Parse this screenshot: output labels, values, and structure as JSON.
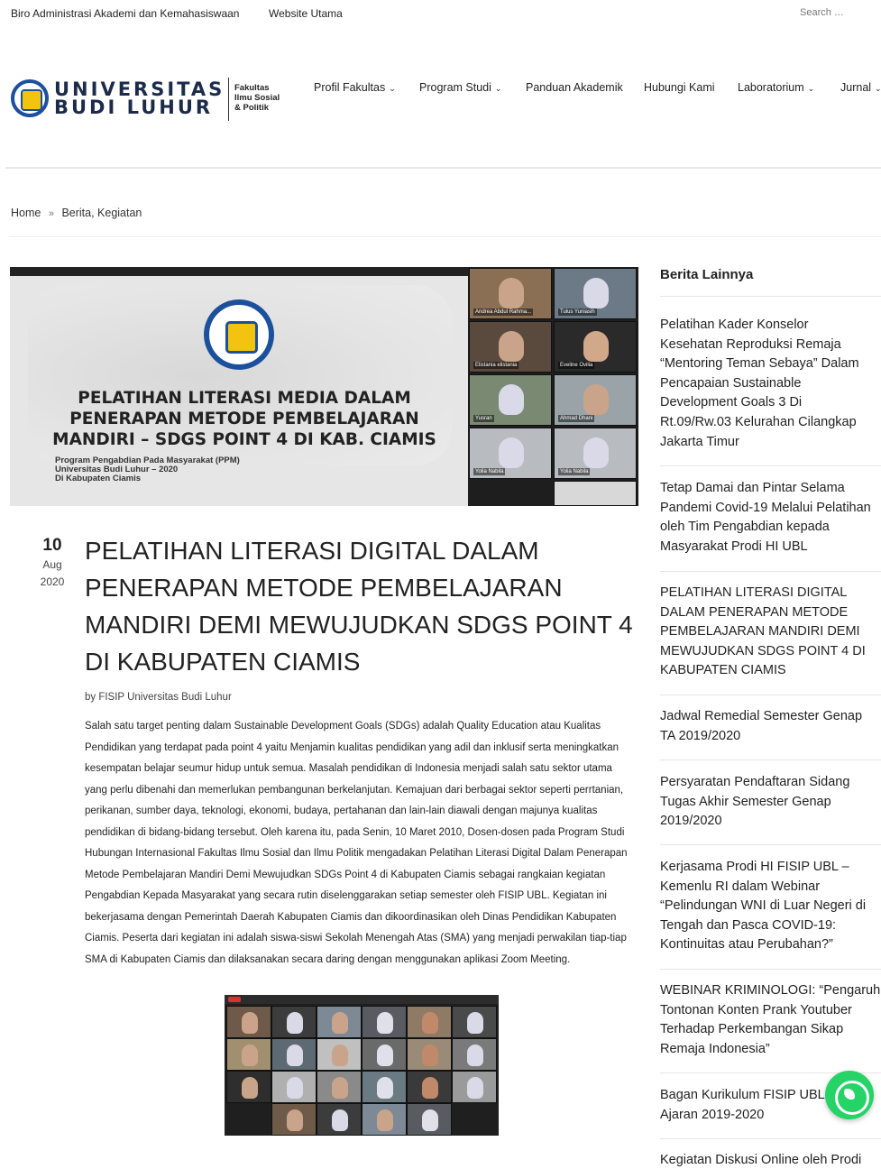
{
  "topbar": {
    "links": [
      "Biro Administrasi Akademi dan Kemahasiswaan",
      "Website Utama"
    ],
    "search_placeholder": "Search …"
  },
  "logo": {
    "line1": "UNIVERSITAS",
    "line2": "BUDI LUHUR",
    "faculty": [
      "Fakultas",
      "Ilmu Sosial",
      "& Politik"
    ]
  },
  "nav": {
    "items": [
      {
        "label": "Profil Fakultas",
        "dropdown": true
      },
      {
        "label": "Program Studi",
        "dropdown": true
      },
      {
        "label": "Panduan Akademik",
        "dropdown": false
      },
      {
        "label": "Hubungi Kami",
        "dropdown": false
      },
      {
        "label": "Laboratorium",
        "dropdown": true
      },
      {
        "label": "Jurnal",
        "dropdown": true
      }
    ]
  },
  "breadcrumb": {
    "home": "Home",
    "separator": "»",
    "current": "Berita, Kegiatan"
  },
  "feature_image": {
    "title": "PELATIHAN LITERASI MEDIA DALAM PENERAPAN METODE PEMBELAJARAN MANDIRI – SDGS POINT 4 DI KAB. CIAMIS",
    "subtitle": [
      "Program Pengabdian Pada Masyarakat (PPM)",
      "Universitas Budi Luhur – 2020",
      "Di Kabupaten Ciamis"
    ],
    "participants": [
      "Andrea Abdul Rahma...",
      "Tulus Yuniasih",
      "Elistania elistania",
      "Eveline Ovilia",
      "Yusran",
      "Ahmad Dhani",
      "Yolia Nabila",
      "Yolia Nabila"
    ]
  },
  "post": {
    "date": {
      "day": "10",
      "month": "Aug",
      "year": "2020"
    },
    "title": "PELATIHAN LITERASI DIGITAL DALAM PENERAPAN METODE PEMBELAJARAN MANDIRI DEMI MEWUJUDKAN SDGS POINT 4 DI KABUPATEN CIAMIS",
    "author": "by FISIP Universitas Budi Luhur",
    "body": "Salah satu target penting dalam Sustainable Development Goals (SDGs) adalah Quality Education atau Kualitas Pendidikan yang terdapat pada point 4 yaitu Menjamin kualitas pendidikan yang adil dan inklusif serta meningkatkan kesempatan belajar seumur hidup untuk semua. Masalah pendidikan di Indonesia menjadi salah satu sektor utama yang perlu dibenahi dan memerlukan pembangunan berkelanjutan. Kemajuan dari berbagai sektor seperti perrtanian, perikanan, sumber daya, teknologi, ekonomi, budaya, pertahanan dan lain-lain diawali dengan majunya kualitas pendidikan di bidang-bidang tersebut. Oleh karena itu, pada Senin, 10 Maret 2010, Dosen-dosen pada Program Studi Hubungan Internasional Fakultas Ilmu Sosial dan Ilmu Politik mengadakan Pelatihan Literasi Digital Dalam Penerapan Metode Pembelajaran Mandiri Demi Mewujudkan SDGs Point 4 di Kabupaten Ciamis sebagai rangkaian kegiatan Pengabdian Kepada Masyarakat yang secara rutin diselenggarakan setiap semester oleh FISIP UBL. Kegiatan ini bekerjasama dengan Pemerintah Daerah Kabupaten Ciamis dan dikoordinasikan oleh Dinas Pendidikan Kabupaten Ciamis. Peserta dari kegiatan ini adalah siswa-siswi Sekolah Menengah Atas (SMA) yang menjadi perwakilan tiap-tiap SMA di Kabupaten Ciamis dan dilaksanakan secara daring dengan menggunakan aplikasi Zoom Meeting."
  },
  "sidebar": {
    "heading": "Berita Lainnya",
    "items": [
      "Pelatihan Kader Konselor\nKesehatan Reproduksi Remaja\n“Mentoring Teman Sebaya” Dalam\nPencapaian Sustainable\nDevelopment Goals 3 Di\nRt.09/Rw.03 Kelurahan Cilangkap\nJakarta Timur",
      "Tetap Damai dan Pintar Selama\nPandemi Covid-19 Melalui Pelatihan\noleh Tim Pengabdian kepada\nMasyarakat Prodi HI UBL",
      "PELATIHAN LITERASI DIGITAL\nDALAM PENERAPAN METODE\nPEMBELAJARAN MANDIRI DEMI\nMEWUJUDKAN SDGS POINT 4 DI\nKABUPATEN CIAMIS",
      "Jadwal Remedial Semester Genap\nTA 2019/2020",
      "Persyaratan Pendaftaran Sidang\nTugas Akhir Semester Genap\n2019/2020",
      "Kerjasama Prodi HI FISIP UBL –\nKemenlu RI dalam Webinar\n“Pelindungan WNI di Luar Negeri di\nTengah dan Pasca COVID-19:\nKontinuitas atau Perubahan?”",
      "WEBINAR KRIMINOLOGI: “Pengaruh\nTontonan Konten Prank Youtuber\nTerhadap Perkembangan Sikap\nRemaja Indonesia”",
      "Bagan Kurikulum FISIP UBL Tahun\nAjaran 2019-2020",
      "Kegiatan Diskusi Online oleh Prodi"
    ]
  },
  "colors": {
    "brand_blue": "#1c4f9c",
    "brand_yellow": "#f2c40f",
    "whatsapp": "#25d366"
  }
}
